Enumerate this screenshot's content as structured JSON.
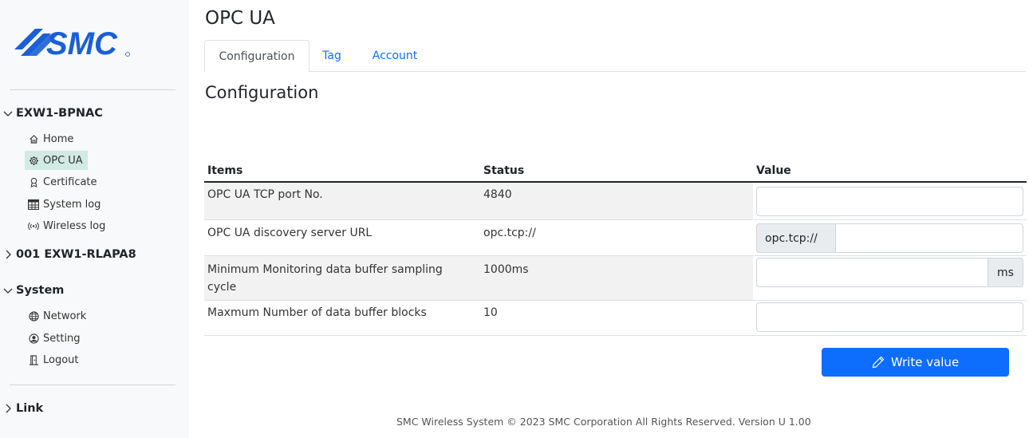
{
  "brand": {
    "logo_text": "SMC",
    "logo_color": "#1a5fd6"
  },
  "sidebar": {
    "group1": {
      "label": "EXW1-BPNAC",
      "expanded": true
    },
    "group1_items": [
      {
        "label": "Home",
        "icon": "home-icon"
      },
      {
        "label": "OPC UA",
        "icon": "gear-icon",
        "active": true
      },
      {
        "label": "Certificate",
        "icon": "certificate-icon"
      },
      {
        "label": "System log",
        "icon": "table-icon"
      },
      {
        "label": "Wireless log",
        "icon": "wireless-icon"
      }
    ],
    "group2": {
      "label": "001 EXW1-RLAPA8",
      "expanded": false
    },
    "group3": {
      "label": "System",
      "expanded": true
    },
    "group3_items": [
      {
        "label": "Network",
        "icon": "globe-icon"
      },
      {
        "label": "Setting",
        "icon": "user-circle-icon"
      },
      {
        "label": "Logout",
        "icon": "logout-icon"
      }
    ],
    "group4": {
      "label": "Link",
      "expanded": false
    }
  },
  "page": {
    "title": "OPC UA",
    "section_title": "Configuration"
  },
  "tabs": [
    {
      "label": "Configuration",
      "active": true
    },
    {
      "label": "Tag",
      "active": false
    },
    {
      "label": "Account",
      "active": false
    }
  ],
  "table": {
    "headers": {
      "items": "Items",
      "status": "Status",
      "value": "Value"
    },
    "rows": [
      {
        "item": "OPC UA TCP port No.",
        "status": "4840",
        "value": ""
      },
      {
        "item": "OPC UA discovery server URL",
        "status": "opc.tcp://",
        "prefix": "opc.tcp://",
        "value": ""
      },
      {
        "item_line1": "Minimum Monitoring data buffer sampling",
        "item_line2": "cycle",
        "status": "1000ms",
        "suffix": "ms",
        "value": ""
      },
      {
        "item": "Maxmum Number of data buffer blocks",
        "status": "10",
        "value": ""
      }
    ]
  },
  "actions": {
    "write_label": "Write value",
    "write_icon": "pencil-icon"
  },
  "footer": {
    "text": "SMC Wireless System © 2023 SMC Corporation All Rights Reserved. Version U 1.00"
  },
  "colors": {
    "primary": "#0d6efd",
    "active_item_bg": "#d1ebe4"
  }
}
